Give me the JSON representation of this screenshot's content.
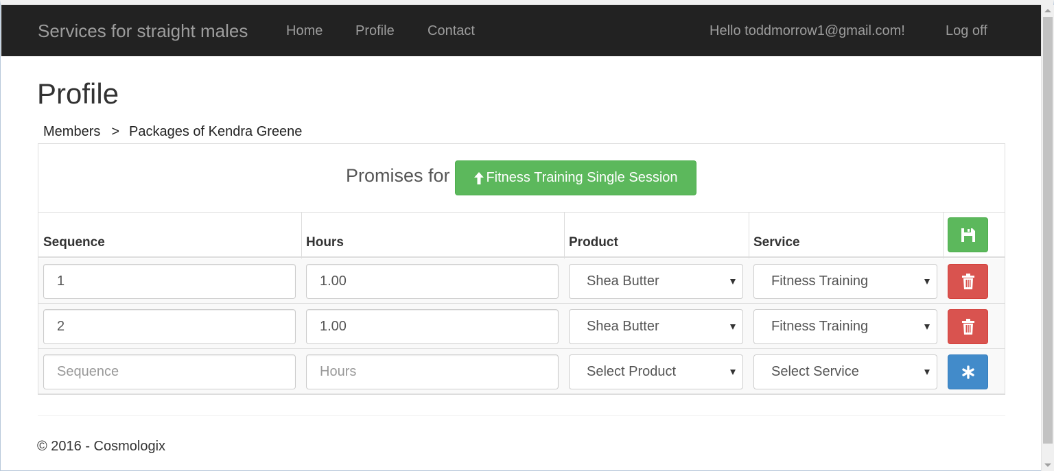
{
  "navbar": {
    "brand": "Services for straight males",
    "links": [
      "Home",
      "Profile",
      "Contact"
    ],
    "greeting": "Hello toddmorrow1@gmail.com!",
    "logoff": "Log off"
  },
  "page": {
    "title": "Profile",
    "breadcrumb": {
      "root": "Members",
      "separator": ">",
      "current": "Packages of Kendra Greene"
    }
  },
  "promises": {
    "label": "Promises for",
    "package_button": "Fitness Training Single Session",
    "package_button_icon": "arrow-up-icon"
  },
  "table": {
    "headers": {
      "sequence": "Sequence",
      "hours": "Hours",
      "product": "Product",
      "service": "Service"
    },
    "save_icon": "floppy-disk-icon",
    "rows": [
      {
        "sequence": "1",
        "hours": "1.00",
        "product": "Shea Butter",
        "service": "Fitness Training",
        "action_icon": "trash-icon"
      },
      {
        "sequence": "2",
        "hours": "1.00",
        "product": "Shea Butter",
        "service": "Fitness Training",
        "action_icon": "trash-icon"
      }
    ],
    "new_row": {
      "sequence_placeholder": "Sequence",
      "hours_placeholder": "Hours",
      "product": "Select Product",
      "service": "Select Service",
      "action_icon": "asterisk-icon"
    }
  },
  "footer": {
    "text": "© 2016 - Cosmologix"
  },
  "colors": {
    "navbar": "#222222",
    "success": "#5cb85c",
    "danger": "#d9534f",
    "primary": "#428bca"
  }
}
